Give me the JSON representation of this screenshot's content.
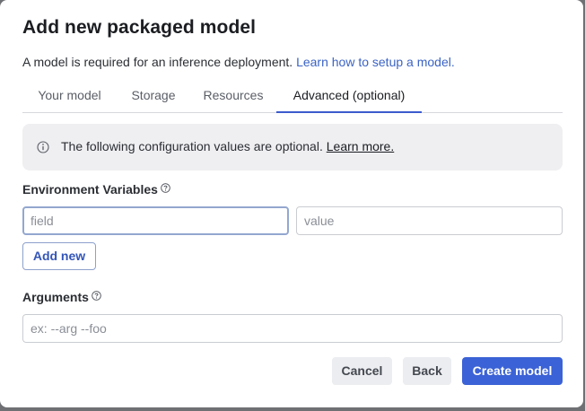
{
  "dialog": {
    "title": "Add new packaged model",
    "subtitle": "A model is required for an inference deployment.",
    "subtitle_link": "Learn how to setup a model."
  },
  "tabs": [
    {
      "label": "Your model",
      "active": false
    },
    {
      "label": "Storage",
      "active": false
    },
    {
      "label": "Resources",
      "active": false
    },
    {
      "label": "Advanced (optional)",
      "active": true
    }
  ],
  "callout": {
    "icon": "info-icon",
    "text": "The following configuration values are optional.",
    "link": "Learn more."
  },
  "env_vars": {
    "label": "Environment Variables",
    "help_icon": "help-circle-icon",
    "field_placeholder": "field",
    "field_value": "",
    "value_placeholder": "value",
    "value_value": "",
    "add_button": "Add new"
  },
  "arguments": {
    "label": "Arguments",
    "help_icon": "help-circle-icon",
    "placeholder": "ex: --arg --foo",
    "value": ""
  },
  "footer": {
    "cancel": "Cancel",
    "back": "Back",
    "create": "Create model"
  },
  "colors": {
    "accent": "#3b62d6",
    "tab_underline": "#3b5bcc",
    "link": "#3b63c4",
    "callout_bg": "#efeff2"
  }
}
